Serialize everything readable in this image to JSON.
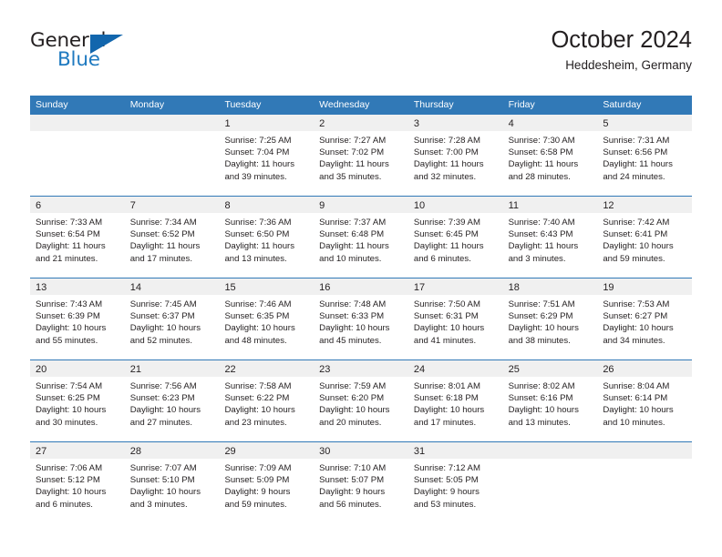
{
  "logo": {
    "word_top": "General",
    "word_bottom": "Blue",
    "accent_color": "#1266ad",
    "blue_text_color": "#1f7ac0",
    "dark_text_color": "#231f20"
  },
  "header": {
    "title": "October 2024",
    "subtitle": "Heddesheim, Germany"
  },
  "calendar": {
    "header_bg": "#3179b7",
    "daynum_band_bg": "#f0f0f0",
    "weekdays": [
      "Sunday",
      "Monday",
      "Tuesday",
      "Wednesday",
      "Thursday",
      "Friday",
      "Saturday"
    ],
    "weeks": [
      [
        {
          "day": "",
          "sunrise": "",
          "sunset": "",
          "daylight_line1": "",
          "daylight_line2": ""
        },
        {
          "day": "",
          "sunrise": "",
          "sunset": "",
          "daylight_line1": "",
          "daylight_line2": ""
        },
        {
          "day": "1",
          "sunrise": "Sunrise: 7:25 AM",
          "sunset": "Sunset: 7:04 PM",
          "daylight_line1": "Daylight: 11 hours",
          "daylight_line2": "and 39 minutes."
        },
        {
          "day": "2",
          "sunrise": "Sunrise: 7:27 AM",
          "sunset": "Sunset: 7:02 PM",
          "daylight_line1": "Daylight: 11 hours",
          "daylight_line2": "and 35 minutes."
        },
        {
          "day": "3",
          "sunrise": "Sunrise: 7:28 AM",
          "sunset": "Sunset: 7:00 PM",
          "daylight_line1": "Daylight: 11 hours",
          "daylight_line2": "and 32 minutes."
        },
        {
          "day": "4",
          "sunrise": "Sunrise: 7:30 AM",
          "sunset": "Sunset: 6:58 PM",
          "daylight_line1": "Daylight: 11 hours",
          "daylight_line2": "and 28 minutes."
        },
        {
          "day": "5",
          "sunrise": "Sunrise: 7:31 AM",
          "sunset": "Sunset: 6:56 PM",
          "daylight_line1": "Daylight: 11 hours",
          "daylight_line2": "and 24 minutes."
        }
      ],
      [
        {
          "day": "6",
          "sunrise": "Sunrise: 7:33 AM",
          "sunset": "Sunset: 6:54 PM",
          "daylight_line1": "Daylight: 11 hours",
          "daylight_line2": "and 21 minutes."
        },
        {
          "day": "7",
          "sunrise": "Sunrise: 7:34 AM",
          "sunset": "Sunset: 6:52 PM",
          "daylight_line1": "Daylight: 11 hours",
          "daylight_line2": "and 17 minutes."
        },
        {
          "day": "8",
          "sunrise": "Sunrise: 7:36 AM",
          "sunset": "Sunset: 6:50 PM",
          "daylight_line1": "Daylight: 11 hours",
          "daylight_line2": "and 13 minutes."
        },
        {
          "day": "9",
          "sunrise": "Sunrise: 7:37 AM",
          "sunset": "Sunset: 6:48 PM",
          "daylight_line1": "Daylight: 11 hours",
          "daylight_line2": "and 10 minutes."
        },
        {
          "day": "10",
          "sunrise": "Sunrise: 7:39 AM",
          "sunset": "Sunset: 6:45 PM",
          "daylight_line1": "Daylight: 11 hours",
          "daylight_line2": "and 6 minutes."
        },
        {
          "day": "11",
          "sunrise": "Sunrise: 7:40 AM",
          "sunset": "Sunset: 6:43 PM",
          "daylight_line1": "Daylight: 11 hours",
          "daylight_line2": "and 3 minutes."
        },
        {
          "day": "12",
          "sunrise": "Sunrise: 7:42 AM",
          "sunset": "Sunset: 6:41 PM",
          "daylight_line1": "Daylight: 10 hours",
          "daylight_line2": "and 59 minutes."
        }
      ],
      [
        {
          "day": "13",
          "sunrise": "Sunrise: 7:43 AM",
          "sunset": "Sunset: 6:39 PM",
          "daylight_line1": "Daylight: 10 hours",
          "daylight_line2": "and 55 minutes."
        },
        {
          "day": "14",
          "sunrise": "Sunrise: 7:45 AM",
          "sunset": "Sunset: 6:37 PM",
          "daylight_line1": "Daylight: 10 hours",
          "daylight_line2": "and 52 minutes."
        },
        {
          "day": "15",
          "sunrise": "Sunrise: 7:46 AM",
          "sunset": "Sunset: 6:35 PM",
          "daylight_line1": "Daylight: 10 hours",
          "daylight_line2": "and 48 minutes."
        },
        {
          "day": "16",
          "sunrise": "Sunrise: 7:48 AM",
          "sunset": "Sunset: 6:33 PM",
          "daylight_line1": "Daylight: 10 hours",
          "daylight_line2": "and 45 minutes."
        },
        {
          "day": "17",
          "sunrise": "Sunrise: 7:50 AM",
          "sunset": "Sunset: 6:31 PM",
          "daylight_line1": "Daylight: 10 hours",
          "daylight_line2": "and 41 minutes."
        },
        {
          "day": "18",
          "sunrise": "Sunrise: 7:51 AM",
          "sunset": "Sunset: 6:29 PM",
          "daylight_line1": "Daylight: 10 hours",
          "daylight_line2": "and 38 minutes."
        },
        {
          "day": "19",
          "sunrise": "Sunrise: 7:53 AM",
          "sunset": "Sunset: 6:27 PM",
          "daylight_line1": "Daylight: 10 hours",
          "daylight_line2": "and 34 minutes."
        }
      ],
      [
        {
          "day": "20",
          "sunrise": "Sunrise: 7:54 AM",
          "sunset": "Sunset: 6:25 PM",
          "daylight_line1": "Daylight: 10 hours",
          "daylight_line2": "and 30 minutes."
        },
        {
          "day": "21",
          "sunrise": "Sunrise: 7:56 AM",
          "sunset": "Sunset: 6:23 PM",
          "daylight_line1": "Daylight: 10 hours",
          "daylight_line2": "and 27 minutes."
        },
        {
          "day": "22",
          "sunrise": "Sunrise: 7:58 AM",
          "sunset": "Sunset: 6:22 PM",
          "daylight_line1": "Daylight: 10 hours",
          "daylight_line2": "and 23 minutes."
        },
        {
          "day": "23",
          "sunrise": "Sunrise: 7:59 AM",
          "sunset": "Sunset: 6:20 PM",
          "daylight_line1": "Daylight: 10 hours",
          "daylight_line2": "and 20 minutes."
        },
        {
          "day": "24",
          "sunrise": "Sunrise: 8:01 AM",
          "sunset": "Sunset: 6:18 PM",
          "daylight_line1": "Daylight: 10 hours",
          "daylight_line2": "and 17 minutes."
        },
        {
          "day": "25",
          "sunrise": "Sunrise: 8:02 AM",
          "sunset": "Sunset: 6:16 PM",
          "daylight_line1": "Daylight: 10 hours",
          "daylight_line2": "and 13 minutes."
        },
        {
          "day": "26",
          "sunrise": "Sunrise: 8:04 AM",
          "sunset": "Sunset: 6:14 PM",
          "daylight_line1": "Daylight: 10 hours",
          "daylight_line2": "and 10 minutes."
        }
      ],
      [
        {
          "day": "27",
          "sunrise": "Sunrise: 7:06 AM",
          "sunset": "Sunset: 5:12 PM",
          "daylight_line1": "Daylight: 10 hours",
          "daylight_line2": "and 6 minutes."
        },
        {
          "day": "28",
          "sunrise": "Sunrise: 7:07 AM",
          "sunset": "Sunset: 5:10 PM",
          "daylight_line1": "Daylight: 10 hours",
          "daylight_line2": "and 3 minutes."
        },
        {
          "day": "29",
          "sunrise": "Sunrise: 7:09 AM",
          "sunset": "Sunset: 5:09 PM",
          "daylight_line1": "Daylight: 9 hours",
          "daylight_line2": "and 59 minutes."
        },
        {
          "day": "30",
          "sunrise": "Sunrise: 7:10 AM",
          "sunset": "Sunset: 5:07 PM",
          "daylight_line1": "Daylight: 9 hours",
          "daylight_line2": "and 56 minutes."
        },
        {
          "day": "31",
          "sunrise": "Sunrise: 7:12 AM",
          "sunset": "Sunset: 5:05 PM",
          "daylight_line1": "Daylight: 9 hours",
          "daylight_line2": "and 53 minutes."
        },
        {
          "day": "",
          "sunrise": "",
          "sunset": "",
          "daylight_line1": "",
          "daylight_line2": ""
        },
        {
          "day": "",
          "sunrise": "",
          "sunset": "",
          "daylight_line1": "",
          "daylight_line2": ""
        }
      ]
    ]
  }
}
